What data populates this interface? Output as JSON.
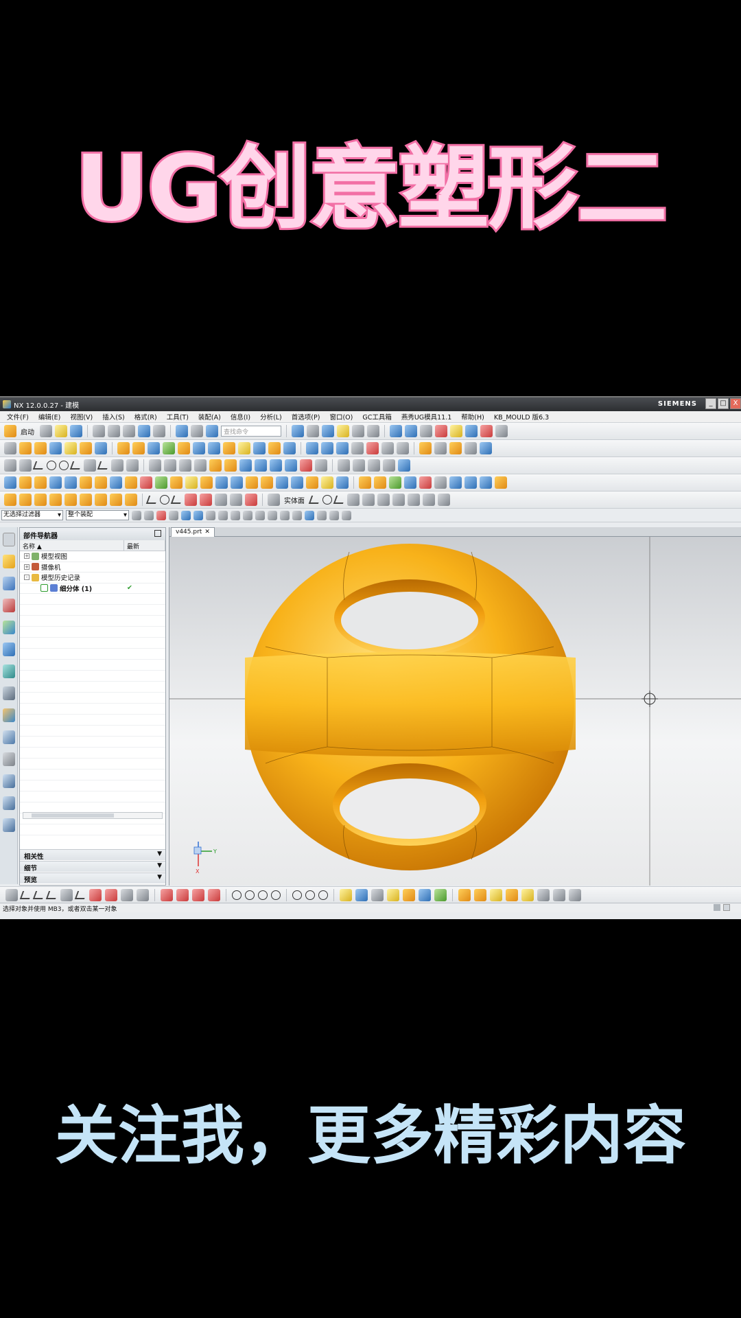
{
  "headline": "UG创意塑形二",
  "footer_caption": "关注我，更多精彩内容",
  "window": {
    "title": "NX 12.0.0.27 - 建模",
    "brand": "SIEMENS",
    "min": "_",
    "max": "□",
    "close": "X"
  },
  "menu": [
    "文件(F)",
    "编辑(E)",
    "视图(V)",
    "插入(S)",
    "格式(R)",
    "工具(T)",
    "装配(A)",
    "信息(I)",
    "分析(L)",
    "首选项(P)",
    "窗口(O)",
    "GC工具箱",
    "燕秀UG模具11.1",
    "帮助(H)",
    "KB_MOULD 版6.3"
  ],
  "toolbar": {
    "start_label": "启动",
    "search_placeholder": "查找命令",
    "solid_label": "实体面"
  },
  "selection": {
    "filter": "无选择过滤器",
    "scope": "整个装配"
  },
  "navigator": {
    "title": "部件导航器",
    "col_name": "名称",
    "col_latest": "最新",
    "rows": [
      {
        "expander": "+",
        "label": "模型视图",
        "latest": ""
      },
      {
        "expander": "+",
        "label": "摄像机",
        "latest": ""
      },
      {
        "expander": "-",
        "label": "模型历史记录",
        "latest": ""
      },
      {
        "expander": "",
        "label": "细分体 (1)",
        "latest": "✔"
      }
    ],
    "sections": [
      "相关性",
      "细节",
      "预览"
    ]
  },
  "viewport": {
    "tab": "v445.prt",
    "triad_y": "Y",
    "triad_x": "X"
  },
  "status": "选择对象并使用 MB3，或者双击某一对象",
  "colors": {
    "model_main": "#f6a813",
    "model_highlight": "#ffdf6a",
    "model_shadow": "#c67a05",
    "headline_fill": "#ffd6ea",
    "headline_stroke": "#f26fa5",
    "caption": "#c5e4f7"
  }
}
